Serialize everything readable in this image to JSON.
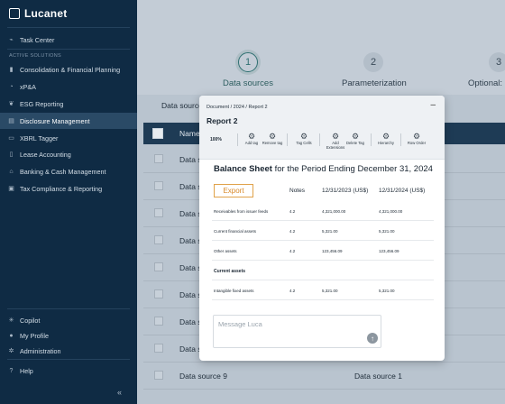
{
  "app": {
    "logo_text": "Lucanet"
  },
  "sidebar": {
    "task_center": "Task Center",
    "section_label": "ACTIVE SOLUTIONS",
    "items": [
      {
        "label": "Consolidation & Financial Planning",
        "icon": "bar-chart-icon"
      },
      {
        "label": "xP&A",
        "icon": "pie-chart-icon"
      },
      {
        "label": "ESG Reporting",
        "icon": "leaf-icon"
      },
      {
        "label": "Disclosure Management",
        "icon": "document-icon",
        "active": true
      },
      {
        "label": "XBRL Tagger",
        "icon": "tag-icon"
      },
      {
        "label": "Lease Accounting",
        "icon": "building-icon"
      },
      {
        "label": "Banking & Cash Management",
        "icon": "bank-icon"
      },
      {
        "label": "Tax Compliance & Reporting",
        "icon": "receipt-icon"
      }
    ],
    "bottom": [
      {
        "label": "Copilot",
        "icon": "sparkle-icon"
      },
      {
        "label": "My Profile",
        "icon": "user-icon"
      },
      {
        "label": "Administration",
        "icon": "gear-icon"
      }
    ],
    "help": "Help",
    "collapse": "«"
  },
  "stepper": {
    "steps": [
      {
        "number": "1",
        "label": "Data sources",
        "active": true
      },
      {
        "number": "2",
        "label": "Parameterization"
      },
      {
        "number": "3",
        "label": "Optional:"
      }
    ]
  },
  "data_sources": {
    "title": "Data source",
    "column_name": "Name",
    "rows": [
      {
        "name": "Data s"
      },
      {
        "name": "Data s"
      },
      {
        "name": "Data s"
      },
      {
        "name": "Data s"
      },
      {
        "name": "Data s"
      },
      {
        "name": "Data s"
      },
      {
        "name": "Data s"
      },
      {
        "name": "Data s"
      },
      {
        "name": "Data source 9",
        "name2": "Data source 1"
      }
    ]
  },
  "modal": {
    "breadcrumb": "Document / 2024 / Report 2",
    "minimize": "–",
    "title": "Report 2",
    "zoom": "100%",
    "tools": [
      {
        "label": "Add tag"
      },
      {
        "label": "Remove tag"
      },
      {
        "label": "Tag Cells"
      },
      {
        "label": "Add Extensions"
      },
      {
        "label": "Delete Tag"
      },
      {
        "label": "Hierarchy"
      },
      {
        "label": "Row Order"
      }
    ],
    "sheet_title_bold": "Balance Sheet",
    "sheet_title_rest": " for the Period Ending December 31, 2024",
    "export": "Export",
    "columns": [
      "Notes",
      "12/31/2023 (US$)",
      "12/31/2024 (US$)"
    ],
    "rows": [
      {
        "label": "Receivables from issuer feeds",
        "note": "4.2",
        "v2023": "4,321,000.00",
        "v2024": "4,321,000.00"
      },
      {
        "label": "Current financial assets",
        "note": "4.2",
        "v2023": "5,321.00",
        "v2024": "5,321.00"
      },
      {
        "label": "Other assets",
        "note": "4.2",
        "v2023": "123,456.09",
        "v2024": "123,456.09"
      },
      {
        "label": "Current assets",
        "header": true
      },
      {
        "label": "Intangible fixed assets",
        "note": "4.2",
        "v2023": "5,321.00",
        "v2024": "5,321.00"
      }
    ],
    "message_placeholder": "Message Luca",
    "send_icon": "arrow-up-icon"
  }
}
